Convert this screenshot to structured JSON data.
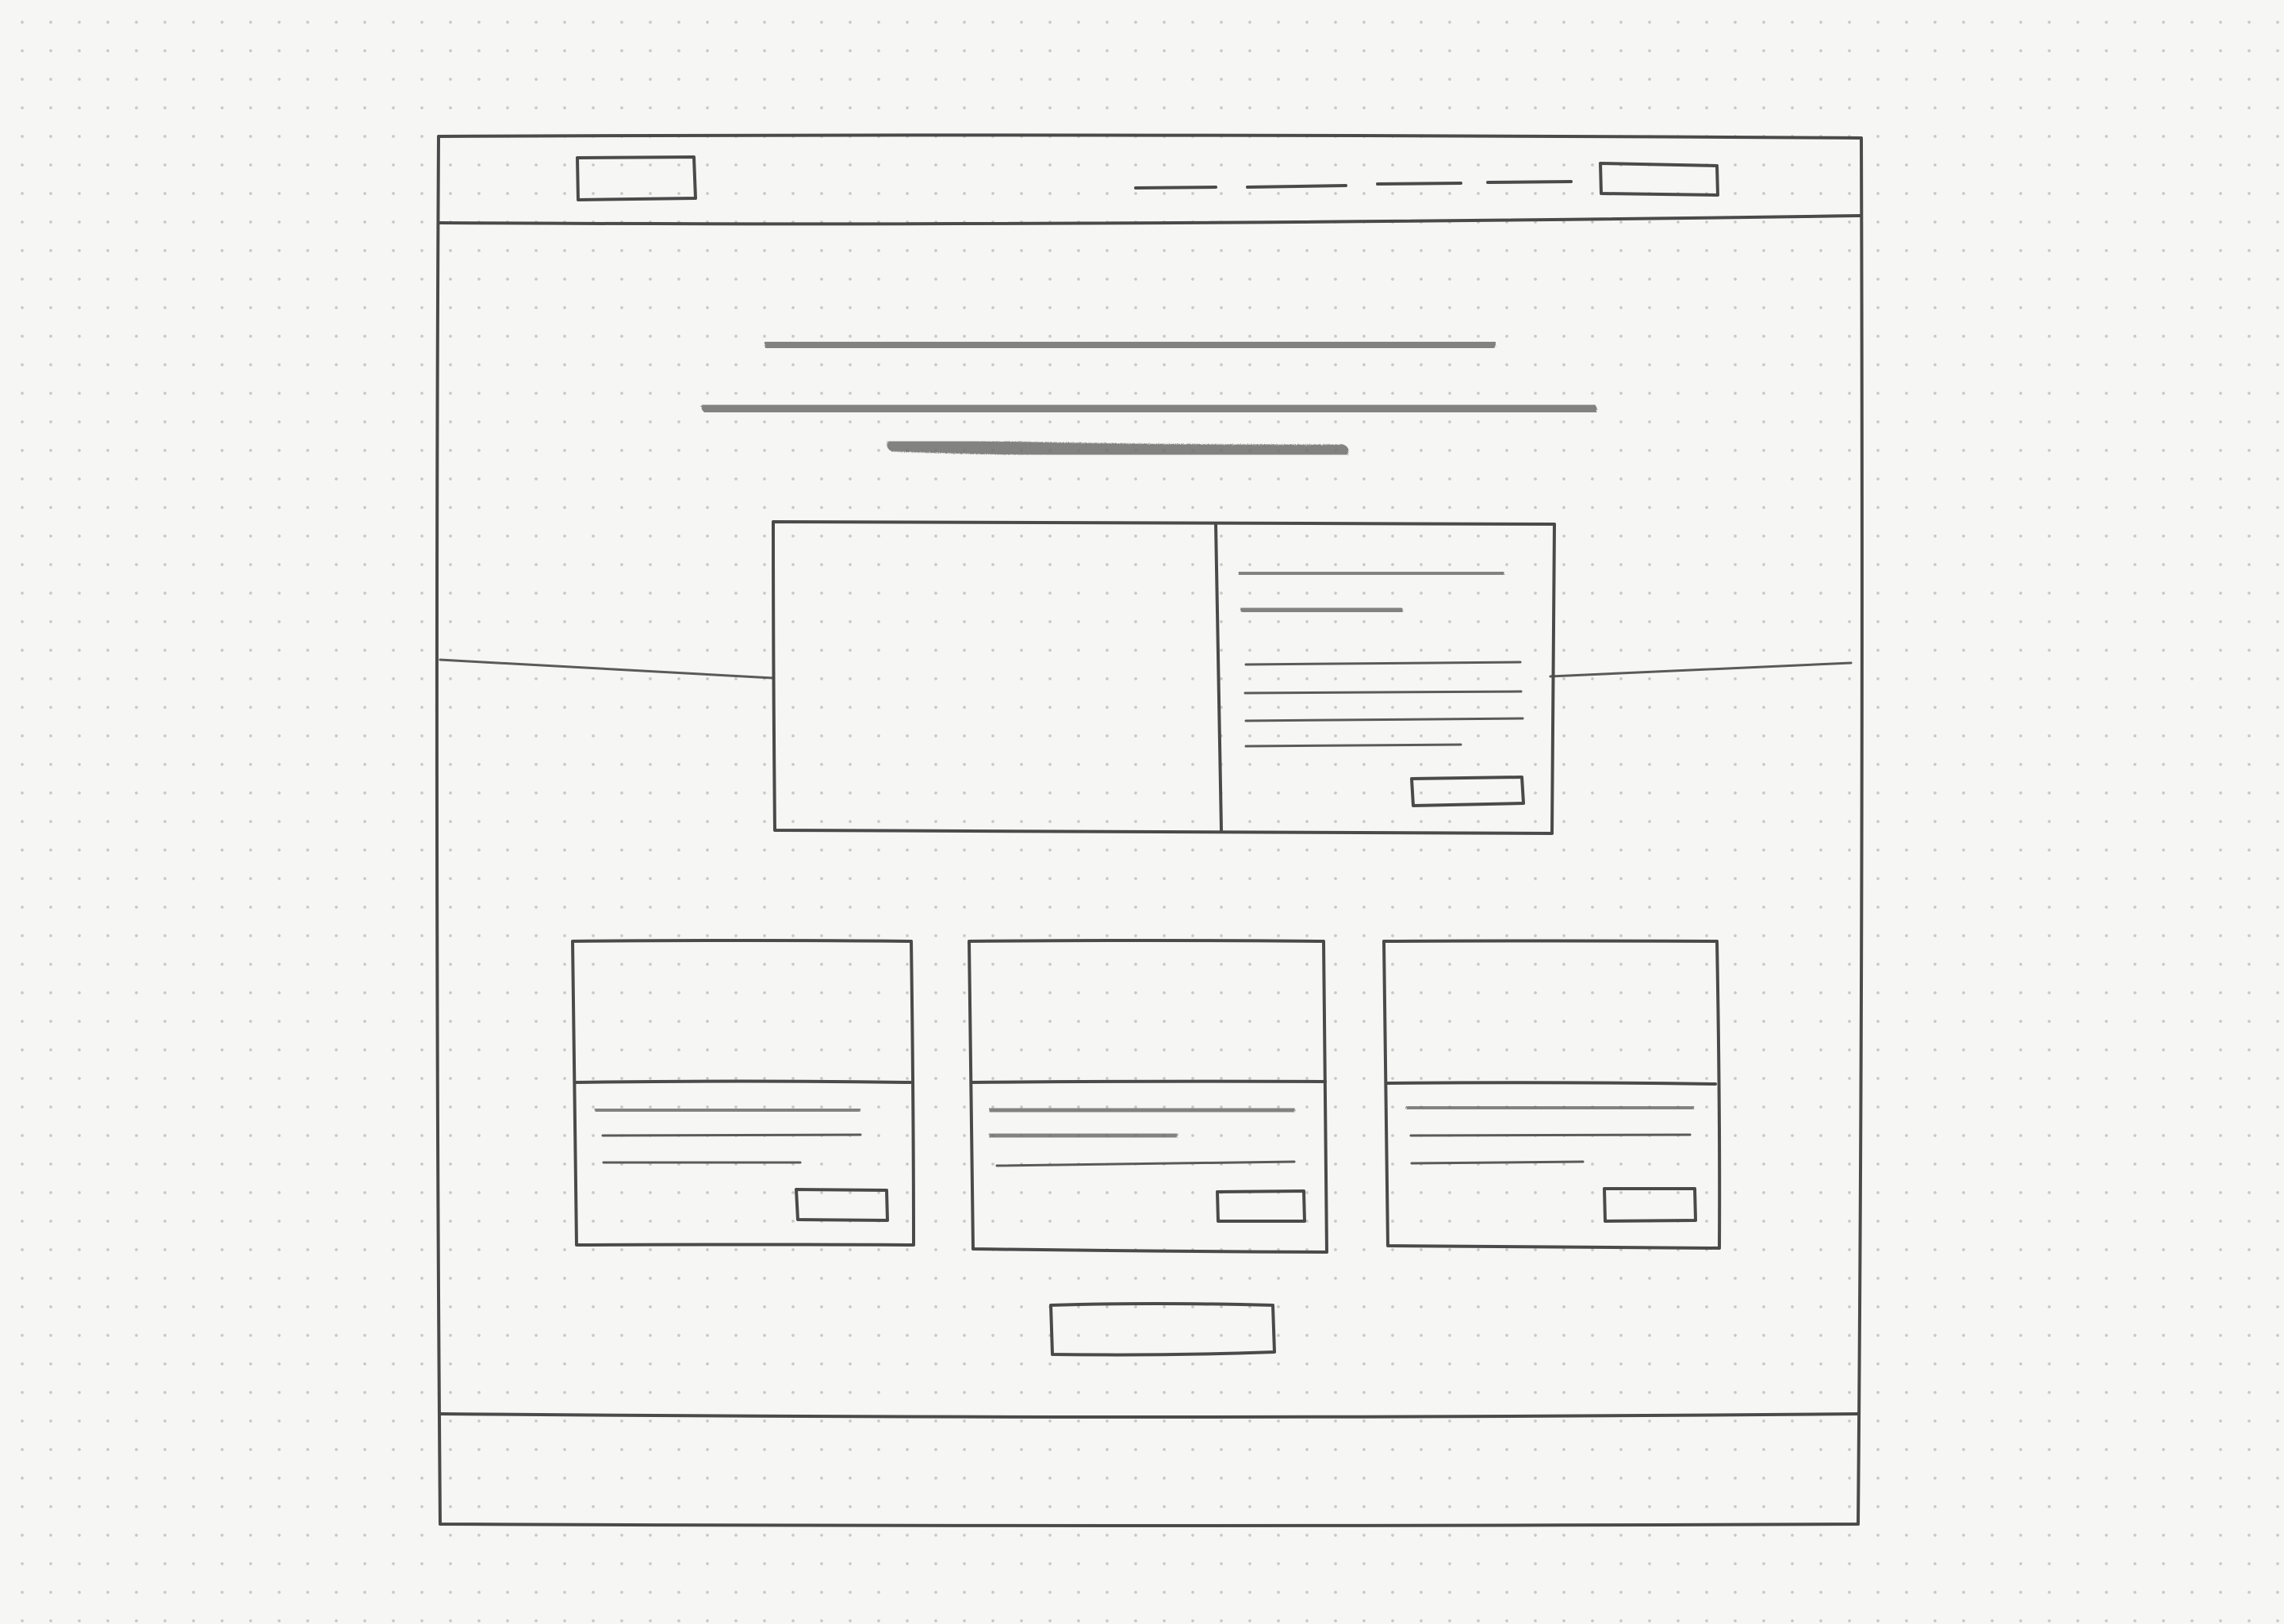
{
  "wireframe": {
    "nav_link_count": 4,
    "card_count": 3,
    "featured_body_line_count": 4
  },
  "colors": {
    "paper": "#f6f6f4",
    "pencil": "#4a4a4a",
    "dot_grid": "#c9c9c6"
  }
}
